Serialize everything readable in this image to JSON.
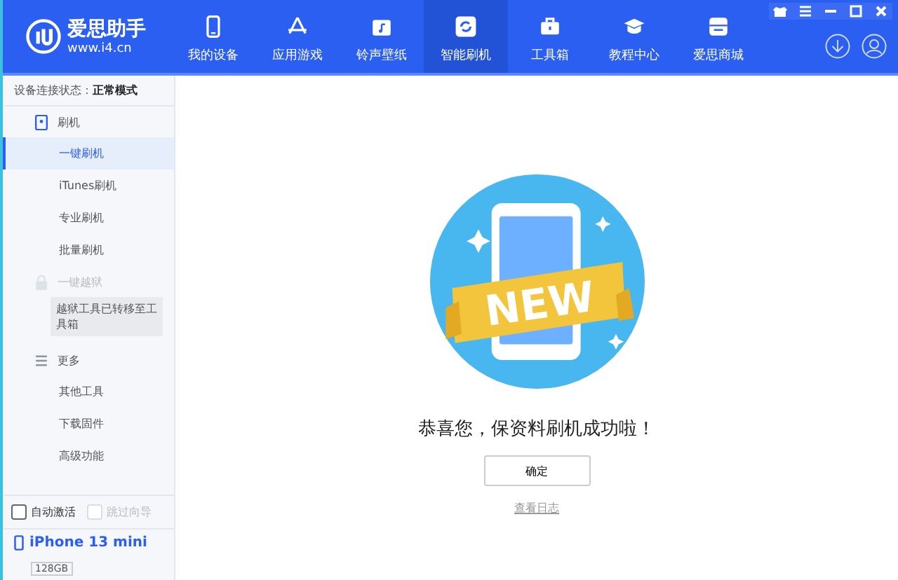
{
  "app": {
    "name": "爱思助手",
    "url": "www.i4.cn"
  },
  "nav": [
    {
      "kind": "phone",
      "label": "我的设备",
      "selected": false
    },
    {
      "kind": "apps",
      "label": "应用游戏",
      "selected": false
    },
    {
      "kind": "music",
      "label": "铃声壁纸",
      "selected": false
    },
    {
      "kind": "flash",
      "label": "智能刷机",
      "selected": true
    },
    {
      "kind": "toolbox",
      "label": "工具箱",
      "selected": false
    },
    {
      "kind": "cap",
      "label": "教程中心",
      "selected": false
    },
    {
      "kind": "store",
      "label": "爱思商城",
      "selected": false
    }
  ],
  "sidebar": {
    "status_label": "设备连接状态：",
    "status_value": "正常模式",
    "groups": [
      {
        "kind": "phone",
        "label": "刷机",
        "disabled": false,
        "items": [
          {
            "label": "一键刷机",
            "selected": true
          },
          {
            "label": "iTunes刷机",
            "selected": false
          },
          {
            "label": "专业刷机",
            "selected": false
          },
          {
            "label": "批量刷机",
            "selected": false
          }
        ]
      },
      {
        "kind": "lock",
        "label": "一键越狱",
        "disabled": true,
        "note": "越狱工具已转移至工具箱"
      },
      {
        "kind": "menu",
        "label": "更多",
        "disabled": false,
        "items": [
          {
            "label": "其他工具",
            "selected": false
          },
          {
            "label": "下载固件",
            "selected": false
          },
          {
            "label": "高级功能",
            "selected": false
          }
        ]
      }
    ],
    "options": [
      {
        "label": "自动激活",
        "checked": false,
        "disabled": false
      },
      {
        "label": "跳过向导",
        "checked": false,
        "disabled": true
      }
    ],
    "device": {
      "name": "iPhone 13 mini",
      "capacity": "128GB"
    }
  },
  "main": {
    "badge": "NEW",
    "message": "恭喜您，保资料刷机成功啦！",
    "confirm": "确定",
    "log_link": "查看日志"
  }
}
